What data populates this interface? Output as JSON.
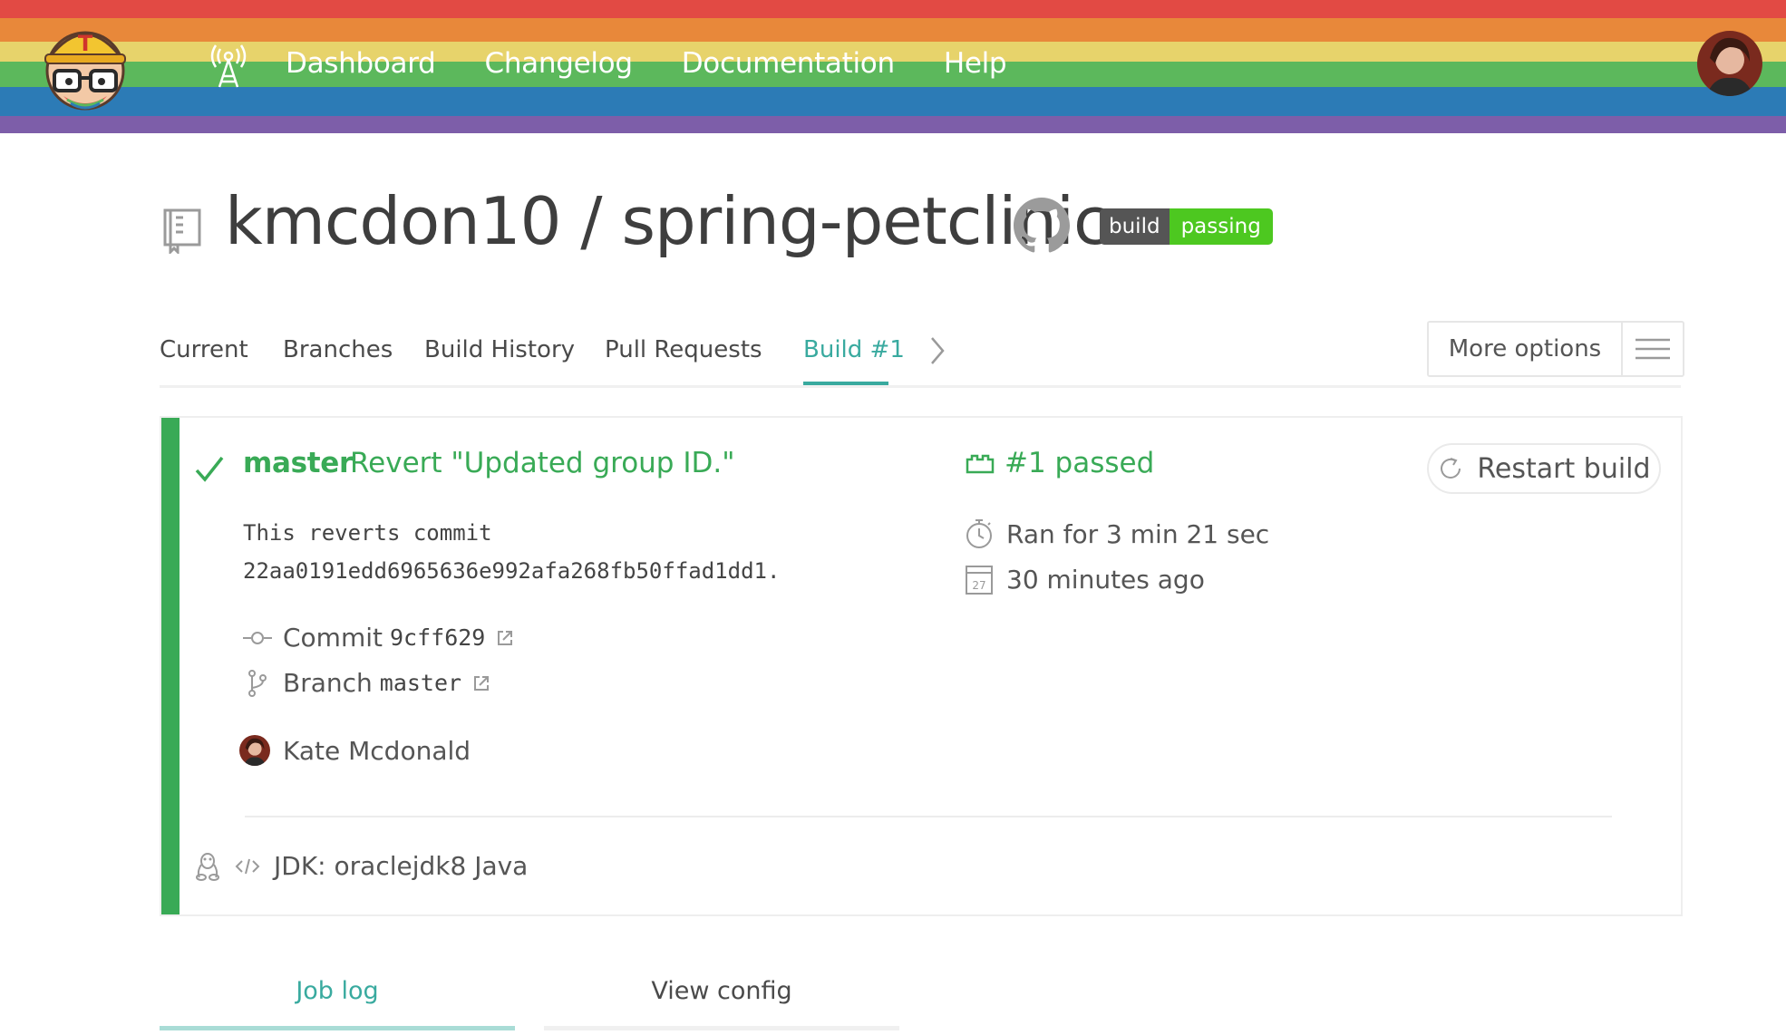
{
  "colors": {
    "accent_teal": "#39aa9f",
    "passed_green": "#39aa56",
    "badge_green": "#4dc820",
    "badge_gray": "#555555",
    "rainbow": [
      "#e24a44",
      "#e8883a",
      "#e7d36b",
      "#5cb85c",
      "#2c7bb6",
      "#7d5ea9"
    ]
  },
  "header": {
    "logo_icon": "travis-mascot-logo",
    "broadcast_icon": "broadcast-tower-icon",
    "nav": [
      "Dashboard",
      "Changelog",
      "Documentation",
      "Help"
    ],
    "avatar_icon": "user-avatar"
  },
  "repo": {
    "icon": "repository-icon",
    "title": "kmcdon10 / spring-petclinic",
    "github_icon": "github-icon",
    "badge": {
      "left": "build",
      "right": "passing"
    }
  },
  "tabs": {
    "items": [
      "Current",
      "Branches",
      "Build History",
      "Pull Requests"
    ],
    "active": "Build #1",
    "more_options": "More options",
    "menu_icon": "hamburger-menu-icon"
  },
  "build": {
    "branch": "master",
    "commit_title": "Revert \"Updated group ID.\"",
    "message_line1": "This reverts commit",
    "message_line2": "22aa0191edd6965636e992afa268fb50ffad1dd1.",
    "commit_label": "Commit",
    "commit_sha": "9cff629",
    "branch_label": "Branch",
    "branch_value": "master",
    "author": "Kate Mcdonald",
    "status": "#1 passed",
    "duration": "Ran for 3 min 21 sec",
    "finished": "30 minutes ago",
    "calendar_day": "27",
    "restart": "Restart build",
    "job": "JDK: oraclejdk8 Java"
  },
  "bottom_tabs": {
    "job_log": "Job log",
    "view_config": "View config"
  }
}
